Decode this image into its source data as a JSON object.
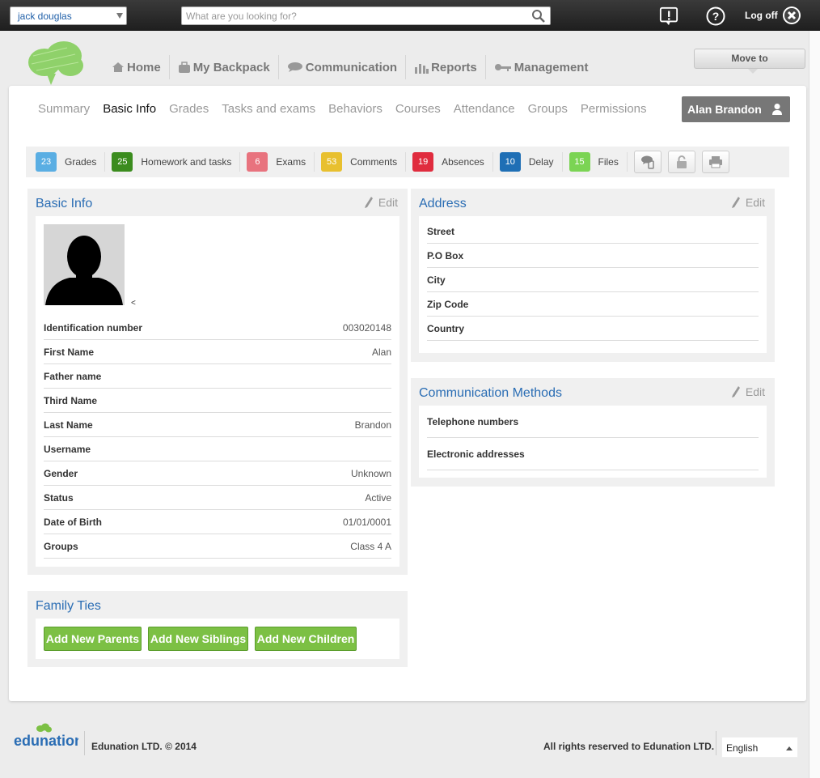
{
  "topbar": {
    "user_select_value": "jack douglas",
    "search_placeholder": "What are you looking for?",
    "logoff_label": "Log off"
  },
  "nav": {
    "items": [
      {
        "label": "Home",
        "icon": "home-icon"
      },
      {
        "label": "My Backpack",
        "icon": "backpack-icon"
      },
      {
        "label": "Communication",
        "icon": "speech-bubble-icon"
      },
      {
        "label": "Reports",
        "icon": "bar-chart-icon"
      },
      {
        "label": "Management",
        "icon": "key-icon"
      }
    ],
    "move_to_label": "Move to"
  },
  "subnav": {
    "tabs": [
      "Summary",
      "Basic Info",
      "Grades",
      "Tasks and exams",
      "Behaviors",
      "Courses",
      "Attendance",
      "Groups",
      "Permissions"
    ],
    "active": "Basic Info",
    "profile_name": "Alan Brandon"
  },
  "counts": [
    {
      "value": "23",
      "label": "Grades",
      "color": "#5aaee3"
    },
    {
      "value": "25",
      "label": "Homework and tasks",
      "color": "#3b8c1e"
    },
    {
      "value": "6",
      "label": "Exams",
      "color": "#e8737e"
    },
    {
      "value": "53",
      "label": "Comments",
      "color": "#e8c02f"
    },
    {
      "value": "19",
      "label": "Absences",
      "color": "#e02c3e"
    },
    {
      "value": "10",
      "label": "Delay",
      "color": "#1f6fb5"
    },
    {
      "value": "15",
      "label": "Files",
      "color": "#7bd454"
    }
  ],
  "basic_info": {
    "title": "Basic Info",
    "edit_label": "Edit",
    "photo_caption": "<",
    "fields": [
      {
        "key": "Identification number",
        "value": "003020148"
      },
      {
        "key": "First Name",
        "value": "Alan"
      },
      {
        "key": "Father name",
        "value": ""
      },
      {
        "key": "Third Name",
        "value": ""
      },
      {
        "key": "Last Name",
        "value": "Brandon"
      },
      {
        "key": "Username",
        "value": ""
      },
      {
        "key": "Gender",
        "value": "Unknown"
      },
      {
        "key": "Status",
        "value": "Active"
      },
      {
        "key": "Date of Birth",
        "value": "01/01/0001"
      },
      {
        "key": "Groups",
        "value": "Class 4 A"
      }
    ]
  },
  "address": {
    "title": "Address",
    "edit_label": "Edit",
    "fields": [
      "Street",
      "P.O Box",
      "City",
      "Zip Code",
      "Country"
    ]
  },
  "communication": {
    "title": "Communication Methods",
    "edit_label": "Edit",
    "fields": [
      "Telephone numbers",
      "Electronic addresses"
    ]
  },
  "family": {
    "title": "Family Ties",
    "buttons": [
      "Add New Parents",
      "Add New Siblings",
      "Add New Children"
    ]
  },
  "footer": {
    "logo_text": "edunation",
    "copyright": "Edunation LTD. © 2014",
    "rights": "All rights reserved to Edunation LTD.",
    "language": "English"
  }
}
